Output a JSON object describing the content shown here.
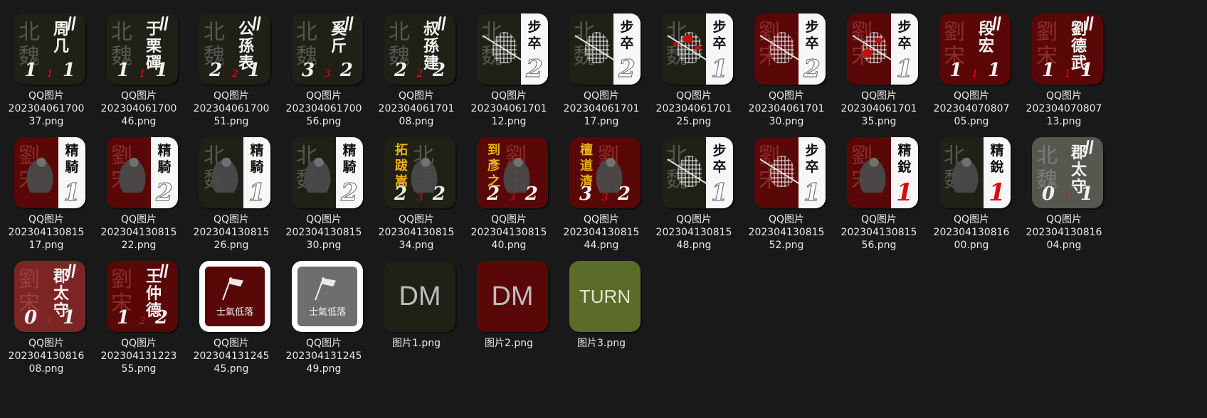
{
  "colors": {
    "background": "#191919",
    "tile_dark": "#202017",
    "tile_red": "#5a0707",
    "tile_olive": "#5b6b28",
    "stat_red": "#e21212",
    "gold_text": "#e9b21c"
  },
  "files": [
    {
      "l1": "QQ图片",
      "l2": "202304061700",
      "l3": "37.png",
      "bg": "北魏",
      "name": "周几",
      "left": "1",
      "mid": "1",
      "right": "1"
    },
    {
      "l1": "QQ图片",
      "l2": "202304061700",
      "l3": "46.png",
      "bg": "北魏",
      "name": "于栗磾",
      "left": "1",
      "mid": "1",
      "right": "1"
    },
    {
      "l1": "QQ图片",
      "l2": "202304061700",
      "l3": "51.png",
      "bg": "北魏",
      "name": "公孫表",
      "left": "2",
      "mid": "2",
      "right": "1"
    },
    {
      "l1": "QQ图片",
      "l2": "202304061700",
      "l3": "56.png",
      "bg": "北魏",
      "name": "奚斤",
      "left": "3",
      "mid": "3",
      "right": "2"
    },
    {
      "l1": "QQ图片",
      "l2": "202304061701",
      "l3": "08.png",
      "bg": "北魏",
      "name": "叔孫建",
      "left": "2",
      "mid": "2",
      "right": "2"
    },
    {
      "l1": "QQ图片",
      "l2": "202304061701",
      "l3": "12.png",
      "bg": "北魏",
      "panel": "步卒",
      "num": "2"
    },
    {
      "l1": "QQ图片",
      "l2": "202304061701",
      "l3": "17.png",
      "bg": "北魏",
      "panel": "步卒",
      "num": "2"
    },
    {
      "l1": "QQ图片",
      "l2": "202304061701",
      "l3": "25.png",
      "bg": "北魏",
      "panel": "步卒",
      "num": "1"
    },
    {
      "l1": "QQ图片",
      "l2": "202304061701",
      "l3": "30.png",
      "bg": "劉宋",
      "panel": "步卒",
      "num": "2"
    },
    {
      "l1": "QQ图片",
      "l2": "202304061701",
      "l3": "35.png",
      "bg": "劉宋",
      "panel": "步卒",
      "num": "1"
    },
    {
      "l1": "QQ图片",
      "l2": "202304070807",
      "l3": "05.png",
      "bg": "劉宋",
      "name": "段宏",
      "left": "1",
      "mid": "1",
      "right": "1"
    },
    {
      "l1": "QQ图片",
      "l2": "202304070807",
      "l3": "13.png",
      "bg": "劉宋",
      "name": "劉德武",
      "left": "1",
      "mid": "1",
      "right": "1"
    },
    {
      "l1": "QQ图片",
      "l2": "202304130815",
      "l3": "17.png",
      "bg": "劉宋",
      "panel": "精騎",
      "num": "1"
    },
    {
      "l1": "QQ图片",
      "l2": "202304130815",
      "l3": "22.png",
      "bg": "劉宋",
      "panel": "精騎",
      "num": "2"
    },
    {
      "l1": "QQ图片",
      "l2": "202304130815",
      "l3": "26.png",
      "bg": "北魏",
      "panel": "精騎",
      "num": "1"
    },
    {
      "l1": "QQ图片",
      "l2": "202304130815",
      "l3": "30.png",
      "bg": "北魏",
      "panel": "精騎",
      "num": "2"
    },
    {
      "l1": "QQ图片",
      "l2": "202304130815",
      "l3": "34.png",
      "bg": "北魏",
      "name": "拓跋嵩",
      "left": "2",
      "mid": "3",
      "right": "2"
    },
    {
      "l1": "QQ图片",
      "l2": "202304130815",
      "l3": "40.png",
      "bg": "劉宋",
      "name": "到彥之",
      "left": "2",
      "mid": "3",
      "right": "2"
    },
    {
      "l1": "QQ图片",
      "l2": "202304130815",
      "l3": "44.png",
      "bg": "劉宋",
      "name": "檀道濟",
      "left": "3",
      "mid": "3",
      "right": "2"
    },
    {
      "l1": "QQ图片",
      "l2": "202304130815",
      "l3": "48.png",
      "bg": "北魏",
      "panel": "步卒",
      "num": "1"
    },
    {
      "l1": "QQ图片",
      "l2": "202304130815",
      "l3": "52.png",
      "bg": "劉宋",
      "panel": "步卒",
      "num": "1"
    },
    {
      "l1": "QQ图片",
      "l2": "202304130815",
      "l3": "56.png",
      "bg": "劉宋",
      "panel": "精銳",
      "num": "1"
    },
    {
      "l1": "QQ图片",
      "l2": "202304130816",
      "l3": "00.png",
      "bg": "北魏",
      "panel": "精銳",
      "num": "1"
    },
    {
      "l1": "QQ图片",
      "l2": "202304130816",
      "l3": "04.png",
      "bg": "北魏",
      "name": "郡太守",
      "left": "0",
      "mid": "1",
      "right": "1"
    },
    {
      "l1": "QQ图片",
      "l2": "202304130816",
      "l3": "08.png",
      "bg": "劉宋",
      "name": "郡太守",
      "left": "0",
      "mid": "1",
      "right": "1"
    },
    {
      "l1": "QQ图片",
      "l2": "202304131223",
      "l3": "55.png",
      "bg": "劉宋",
      "name": "王仲德",
      "left": "1",
      "mid": "2",
      "right": "2"
    },
    {
      "l1": "QQ图片",
      "l2": "202304131245",
      "l3": "45.png",
      "morale": "士氣低落"
    },
    {
      "l1": "QQ图片",
      "l2": "202304131245",
      "l3": "49.png",
      "morale": "士氣低落"
    },
    {
      "l1": "图片1.png",
      "text": "DM"
    },
    {
      "l1": "图片2.png",
      "text": "DM"
    },
    {
      "l1": "图片3.png",
      "text": "TURN"
    }
  ]
}
